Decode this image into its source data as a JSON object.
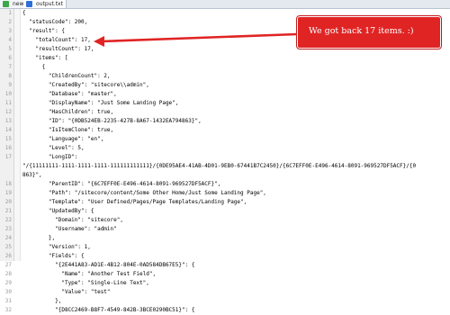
{
  "tabs": [
    {
      "label": "new 1"
    },
    {
      "label": "output.txt"
    }
  ],
  "annotation": {
    "text": "We got back 17 items. :)",
    "color": "#e02424"
  },
  "lines": [
    {
      "n": "1",
      "t": "{"
    },
    {
      "n": "2",
      "t": "  \"statusCode\": 200,"
    },
    {
      "n": "3",
      "t": "  \"result\": {"
    },
    {
      "n": "4",
      "t": "    \"totalCount\": 17,"
    },
    {
      "n": "5",
      "t": "    \"resultCount\": 17,"
    },
    {
      "n": "6",
      "t": "    \"items\": ["
    },
    {
      "n": "7",
      "t": "      {"
    },
    {
      "n": "8",
      "t": "        \"ChildrenCount\": 2,"
    },
    {
      "n": "9",
      "t": "        \"CreatedBy\": \"sitecore\\\\admin\","
    },
    {
      "n": "10",
      "t": "        \"Database\": \"master\","
    },
    {
      "n": "11",
      "t": "        \"DisplayName\": \"Just Some Landing Page\","
    },
    {
      "n": "12",
      "t": "        \"HasChildren\": true,"
    },
    {
      "n": "13",
      "t": "        \"ID\": \"{0DB524EB-2235-427B-8A67-1432EA794863}\","
    },
    {
      "n": "14",
      "t": "        \"IsItemClone\": true,"
    },
    {
      "n": "15",
      "t": "        \"Language\": \"en\","
    },
    {
      "n": "16",
      "t": "        \"Level\": 5,"
    },
    {
      "n": "17",
      "t": "        \"LongID\":"
    },
    {
      "n": "",
      "t": "\"/{11111111-1111-1111-1111-111111111111}/{0DE95AE4-41AB-4D01-9EB0-67441B7C2450}/{6C7EFF0E-E496-4614-8091-969527DF5ACF}/{0"
    },
    {
      "n": "",
      "t": "863}\","
    },
    {
      "n": "18",
      "t": "        \"ParentID\": \"{6C7EFF0E-E496-4614-8091-969527DF5ACF}\","
    },
    {
      "n": "19",
      "t": "        \"Path\": \"/sitecore/content/Some Other Home/Just Some Landing Page\","
    },
    {
      "n": "20",
      "t": "        \"Template\": \"User Defined/Pages/Page Templates/Landing Page\","
    },
    {
      "n": "21",
      "t": "        \"UpdatedBy\": {"
    },
    {
      "n": "22",
      "t": "          \"Domain\": \"sitecore\","
    },
    {
      "n": "23",
      "t": "          \"Username\": \"admin\""
    },
    {
      "n": "24",
      "t": "        },"
    },
    {
      "n": "25",
      "t": "        \"Version\": 1,"
    },
    {
      "n": "26",
      "t": "        \"Fields\": {"
    },
    {
      "n": "27",
      "t": "          \"{2E441A83-AD1E-4B12-804E-0AD584DB67E5}\": {"
    },
    {
      "n": "28",
      "t": "            \"Name\": \"Another Test Field\","
    },
    {
      "n": "29",
      "t": "            \"Type\": \"Single-Line Text\","
    },
    {
      "n": "30",
      "t": "            \"Value\": \"test\""
    },
    {
      "n": "31",
      "t": "          },"
    },
    {
      "n": "32",
      "t": "          \"{D8CC2469-B8F7-4549-842B-3BCE0290BC51}\": {"
    }
  ]
}
